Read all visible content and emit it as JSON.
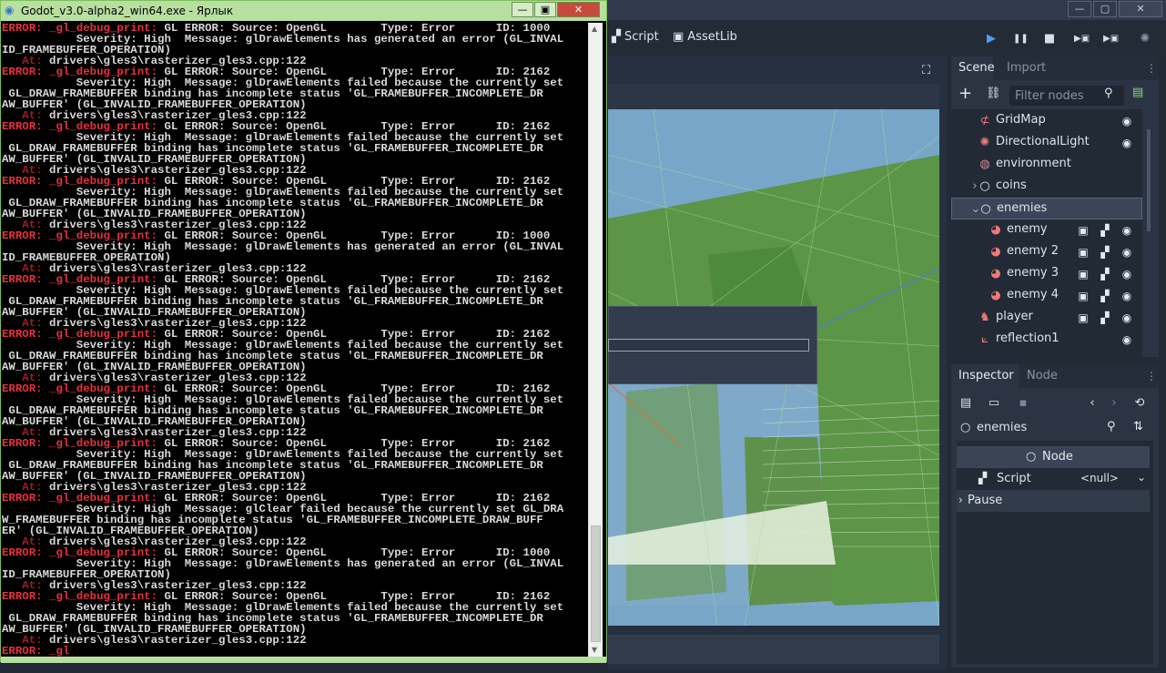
{
  "godot": {
    "window_controls": [
      "—",
      "▢",
      "✕"
    ],
    "topbar": {
      "script_label": "Script",
      "assetlib_label": "AssetLib",
      "play_buttons": [
        "▶",
        "❚❚",
        "■",
        "▶▣",
        "▶▣"
      ]
    }
  },
  "scene_dock": {
    "tabs": [
      "Scene",
      "Import"
    ],
    "filter_placeholder": "Filter nodes",
    "tree": [
      {
        "label": "GridMap",
        "icon": "gridmap-icon",
        "color": "#f07a7a",
        "visibility": true
      },
      {
        "label": "DirectionalLight",
        "icon": "light-icon",
        "color": "#f07a7a",
        "visibility": true
      },
      {
        "label": "environment",
        "icon": "environment-icon",
        "color": "#d68a9a"
      },
      {
        "label": "coins",
        "icon": "node-icon",
        "color": "#e6eaef",
        "expander": "›"
      },
      {
        "label": "enemies",
        "icon": "node-icon",
        "color": "#e6eaef",
        "expander": "⌄",
        "selected": true
      },
      {
        "label": "enemy",
        "icon": "instance-icon",
        "color": "#f07a7a",
        "extras": true,
        "visibility": true
      },
      {
        "label": "enemy 2",
        "icon": "instance-icon",
        "color": "#f07a7a",
        "extras": true,
        "visibility": true
      },
      {
        "label": "enemy 3",
        "icon": "instance-icon",
        "color": "#f07a7a",
        "extras": true,
        "visibility": true
      },
      {
        "label": "enemy 4",
        "icon": "instance-icon",
        "color": "#f07a7a",
        "extras": true,
        "visibility": true
      },
      {
        "label": "player",
        "icon": "kinematic-icon",
        "color": "#f07a7a",
        "extras": true,
        "visibility": true
      },
      {
        "label": "reflection1",
        "icon": "reflection-icon",
        "color": "#f07a7a",
        "visibility": true
      }
    ]
  },
  "inspector": {
    "tabs": [
      "Inspector",
      "Node"
    ],
    "history_buttons": [
      "‹",
      "›",
      "⟲"
    ],
    "object_name": "enemies",
    "section_label": "Node",
    "script_label": "Script",
    "script_value": "<null>",
    "pause_label": "Pause"
  },
  "console": {
    "title": "Godot_v3.0-alpha2_win64.exe - Ярлык",
    "window_controls": [
      "—",
      "▣",
      "✕"
    ],
    "lines": [
      {
        "t": "e",
        "s": "ERROR: _gl_debug_print: GL ERROR: Source: OpenGL        Type: Error      ID: 1000"
      },
      {
        "t": "n",
        "s": "           Severity: High  Message: glDrawElements has generated an error (GL_INVAL"
      },
      {
        "t": "n",
        "s": "ID_FRAMEBUFFER_OPERATION)"
      },
      {
        "t": "a",
        "s": "   At: drivers\\gles3\\rasterizer_gles3.cpp:122"
      },
      {
        "t": "e",
        "s": "ERROR: _gl_debug_print: GL ERROR: Source: OpenGL        Type: Error      ID: 2162"
      },
      {
        "t": "n",
        "s": "           Severity: High  Message: glDrawElements failed because the currently set"
      },
      {
        "t": "n",
        "s": " GL_DRAW_FRAMEBUFFER binding has incomplete status 'GL_FRAMEBUFFER_INCOMPLETE_DR"
      },
      {
        "t": "n",
        "s": "AW_BUFFER' (GL_INVALID_FRAMEBUFFER_OPERATION)"
      },
      {
        "t": "a",
        "s": "   At: drivers\\gles3\\rasterizer_gles3.cpp:122"
      },
      {
        "t": "e",
        "s": "ERROR: _gl_debug_print: GL ERROR: Source: OpenGL        Type: Error      ID: 2162"
      },
      {
        "t": "n",
        "s": "           Severity: High  Message: glDrawElements failed because the currently set"
      },
      {
        "t": "n",
        "s": " GL_DRAW_FRAMEBUFFER binding has incomplete status 'GL_FRAMEBUFFER_INCOMPLETE_DR"
      },
      {
        "t": "n",
        "s": "AW_BUFFER' (GL_INVALID_FRAMEBUFFER_OPERATION)"
      },
      {
        "t": "a",
        "s": "   At: drivers\\gles3\\rasterizer_gles3.cpp:122"
      },
      {
        "t": "e",
        "s": "ERROR: _gl_debug_print: GL ERROR: Source: OpenGL        Type: Error      ID: 2162"
      },
      {
        "t": "n",
        "s": "           Severity: High  Message: glDrawElements failed because the currently set"
      },
      {
        "t": "n",
        "s": " GL_DRAW_FRAMEBUFFER binding has incomplete status 'GL_FRAMEBUFFER_INCOMPLETE_DR"
      },
      {
        "t": "n",
        "s": "AW_BUFFER' (GL_INVALID_FRAMEBUFFER_OPERATION)"
      },
      {
        "t": "a",
        "s": "   At: drivers\\gles3\\rasterizer_gles3.cpp:122"
      },
      {
        "t": "e",
        "s": "ERROR: _gl_debug_print: GL ERROR: Source: OpenGL        Type: Error      ID: 1000"
      },
      {
        "t": "n",
        "s": "           Severity: High  Message: glDrawElements has generated an error (GL_INVAL"
      },
      {
        "t": "n",
        "s": "ID_FRAMEBUFFER_OPERATION)"
      },
      {
        "t": "a",
        "s": "   At: drivers\\gles3\\rasterizer_gles3.cpp:122"
      },
      {
        "t": "e",
        "s": "ERROR: _gl_debug_print: GL ERROR: Source: OpenGL        Type: Error      ID: 2162"
      },
      {
        "t": "n",
        "s": "           Severity: High  Message: glDrawElements failed because the currently set"
      },
      {
        "t": "n",
        "s": " GL_DRAW_FRAMEBUFFER binding has incomplete status 'GL_FRAMEBUFFER_INCOMPLETE_DR"
      },
      {
        "t": "n",
        "s": "AW_BUFFER' (GL_INVALID_FRAMEBUFFER_OPERATION)"
      },
      {
        "t": "a",
        "s": "   At: drivers\\gles3\\rasterizer_gles3.cpp:122"
      },
      {
        "t": "e",
        "s": "ERROR: _gl_debug_print: GL ERROR: Source: OpenGL        Type: Error      ID: 2162"
      },
      {
        "t": "n",
        "s": "           Severity: High  Message: glDrawElements failed because the currently set"
      },
      {
        "t": "n",
        "s": " GL_DRAW_FRAMEBUFFER binding has incomplete status 'GL_FRAMEBUFFER_INCOMPLETE_DR"
      },
      {
        "t": "n",
        "s": "AW_BUFFER' (GL_INVALID_FRAMEBUFFER_OPERATION)"
      },
      {
        "t": "a",
        "s": "   At: drivers\\gles3\\rasterizer_gles3.cpp:122"
      },
      {
        "t": "e",
        "s": "ERROR: _gl_debug_print: GL ERROR: Source: OpenGL        Type: Error      ID: 2162"
      },
      {
        "t": "n",
        "s": "           Severity: High  Message: glDrawElements failed because the currently set"
      },
      {
        "t": "n",
        "s": " GL_DRAW_FRAMEBUFFER binding has incomplete status 'GL_FRAMEBUFFER_INCOMPLETE_DR"
      },
      {
        "t": "n",
        "s": "AW_BUFFER' (GL_INVALID_FRAMEBUFFER_OPERATION)"
      },
      {
        "t": "a",
        "s": "   At: drivers\\gles3\\rasterizer_gles3.cpp:122"
      },
      {
        "t": "e",
        "s": "ERROR: _gl_debug_print: GL ERROR: Source: OpenGL        Type: Error      ID: 2162"
      },
      {
        "t": "n",
        "s": "           Severity: High  Message: glDrawElements failed because the currently set"
      },
      {
        "t": "n",
        "s": " GL_DRAW_FRAMEBUFFER binding has incomplete status 'GL_FRAMEBUFFER_INCOMPLETE_DR"
      },
      {
        "t": "n",
        "s": "AW_BUFFER' (GL_INVALID_FRAMEBUFFER_OPERATION)"
      },
      {
        "t": "a",
        "s": "   At: drivers\\gles3\\rasterizer_gles3.cpp:122"
      },
      {
        "t": "e",
        "s": "ERROR: _gl_debug_print: GL ERROR: Source: OpenGL        Type: Error      ID: 2162"
      },
      {
        "t": "n",
        "s": "           Severity: High  Message: glClear failed because the currently set GL_DRA"
      },
      {
        "t": "n",
        "s": "W_FRAMEBUFFER binding has incomplete status 'GL_FRAMEBUFFER_INCOMPLETE_DRAW_BUFF"
      },
      {
        "t": "n",
        "s": "ER' (GL_INVALID_FRAMEBUFFER_OPERATION)"
      },
      {
        "t": "a",
        "s": "   At: drivers\\gles3\\rasterizer_gles3.cpp:122"
      },
      {
        "t": "e",
        "s": "ERROR: _gl_debug_print: GL ERROR: Source: OpenGL        Type: Error      ID: 1000"
      },
      {
        "t": "n",
        "s": "           Severity: High  Message: glDrawElements has generated an error (GL_INVAL"
      },
      {
        "t": "n",
        "s": "ID_FRAMEBUFFER_OPERATION)"
      },
      {
        "t": "a",
        "s": "   At: drivers\\gles3\\rasterizer_gles3.cpp:122"
      },
      {
        "t": "e",
        "s": "ERROR: _gl_debug_print: GL ERROR: Source: OpenGL        Type: Error      ID: 2162"
      },
      {
        "t": "n",
        "s": "           Severity: High  Message: glDrawElements failed because the currently set"
      },
      {
        "t": "n",
        "s": " GL_DRAW_FRAMEBUFFER binding has incomplete status 'GL_FRAMEBUFFER_INCOMPLETE_DR"
      },
      {
        "t": "n",
        "s": "AW_BUFFER' (GL_INVALID_FRAMEBUFFER_OPERATION)"
      },
      {
        "t": "a",
        "s": "   At: drivers\\gles3\\rasterizer_gles3.cpp:122"
      },
      {
        "t": "e",
        "s": "ERROR: _gl"
      }
    ]
  }
}
